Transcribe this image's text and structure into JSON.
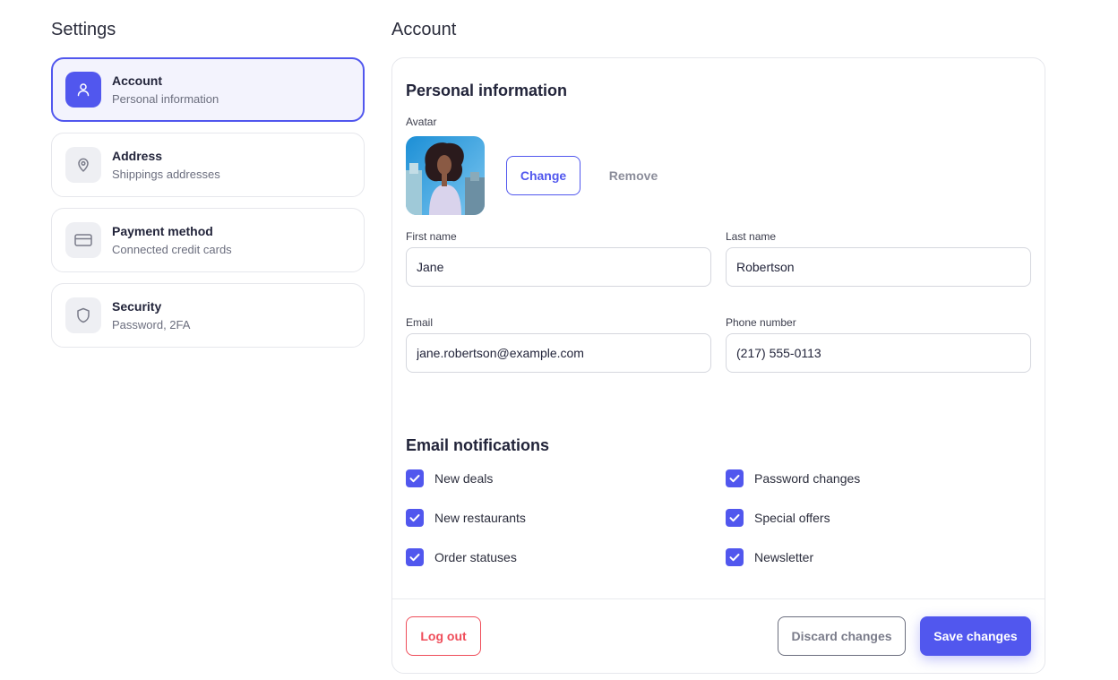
{
  "sidebar": {
    "title": "Settings",
    "items": [
      {
        "title": "Account",
        "subtitle": "Personal information",
        "icon": "user-icon",
        "active": true
      },
      {
        "title": "Address",
        "subtitle": "Shippings addresses",
        "icon": "map-pin-icon",
        "active": false
      },
      {
        "title": "Payment method",
        "subtitle": "Connected credit cards",
        "icon": "credit-card-icon",
        "active": false
      },
      {
        "title": "Security",
        "subtitle": "Password, 2FA",
        "icon": "shield-icon",
        "active": false
      }
    ]
  },
  "main": {
    "title": "Account",
    "personal": {
      "title": "Personal information",
      "avatar_label": "Avatar",
      "change_label": "Change",
      "remove_label": "Remove",
      "first_name_label": "First name",
      "first_name": "Jane",
      "last_name_label": "Last name",
      "last_name": "Robertson",
      "email_label": "Email",
      "email": "jane.robertson@example.com",
      "phone_label": "Phone number",
      "phone": "(217) 555-0113"
    },
    "notifications": {
      "title": "Email notifications",
      "options": [
        {
          "label": "New deals",
          "checked": true
        },
        {
          "label": "New restaurants",
          "checked": true
        },
        {
          "label": "Order statuses",
          "checked": true
        },
        {
          "label": "Password changes",
          "checked": true
        },
        {
          "label": "Special offers",
          "checked": true
        },
        {
          "label": "Newsletter",
          "checked": true
        }
      ]
    },
    "footer": {
      "logout_label": "Log out",
      "discard_label": "Discard changes",
      "save_label": "Save changes"
    }
  },
  "colors": {
    "accent": "#5157ee",
    "danger": "#ef4d5a",
    "border": "#e6e7ec",
    "active_bg": "#f3f3fd"
  }
}
